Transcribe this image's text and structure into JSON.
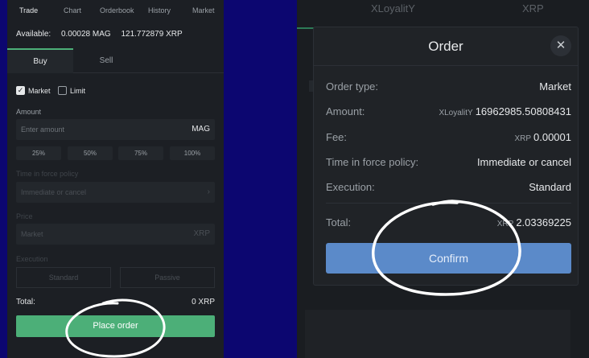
{
  "left": {
    "topnav": [
      "Trade",
      "Chart",
      "Orderbook",
      "History",
      "Market"
    ],
    "available_label": "Available:",
    "available_mag": "0.00028 MAG",
    "available_xrp": "121.772879 XRP",
    "tabs": {
      "buy": "Buy",
      "sell": "Sell"
    },
    "checkbox_market": "Market",
    "checkbox_limit": "Limit",
    "amount_label": "Amount",
    "amount_placeholder": "Enter amount",
    "amount_unit": "MAG",
    "percent_buttons": [
      "25%",
      "50%",
      "75%",
      "100%"
    ],
    "tif_label": "Time in force policy",
    "tif_value": "Immediate or cancel",
    "price_label": "Price",
    "price_value": "Market",
    "price_unit": "XRP",
    "execution_label": "Execution",
    "execution_standard": "Standard",
    "execution_passive": "Passive",
    "total_label": "Total:",
    "total_value": "0 XRP",
    "place_order": "Place order"
  },
  "right": {
    "bg_tabs": [
      "XLoyalitY",
      "XRP"
    ],
    "modal": {
      "title": "Order",
      "close_glyph": "✕",
      "order_type_label": "Order type:",
      "order_type_value": "Market",
      "amount_label": "Amount:",
      "amount_currency": "XLoyalitY",
      "amount_value": "16962985.50808431",
      "fee_label": "Fee:",
      "fee_currency": "XRP",
      "fee_value": "0.00001",
      "tif_label": "Time in force policy:",
      "tif_value": "Immediate or cancel",
      "execution_label": "Execution:",
      "execution_value": "Standard",
      "total_label": "Total:",
      "total_currency": "XRP",
      "total_value": "2.03369225",
      "confirm": "Confirm"
    }
  },
  "colors": {
    "background": "#0c0670",
    "buy_accent": "#4caf78",
    "confirm_button": "#5b8ac9"
  }
}
